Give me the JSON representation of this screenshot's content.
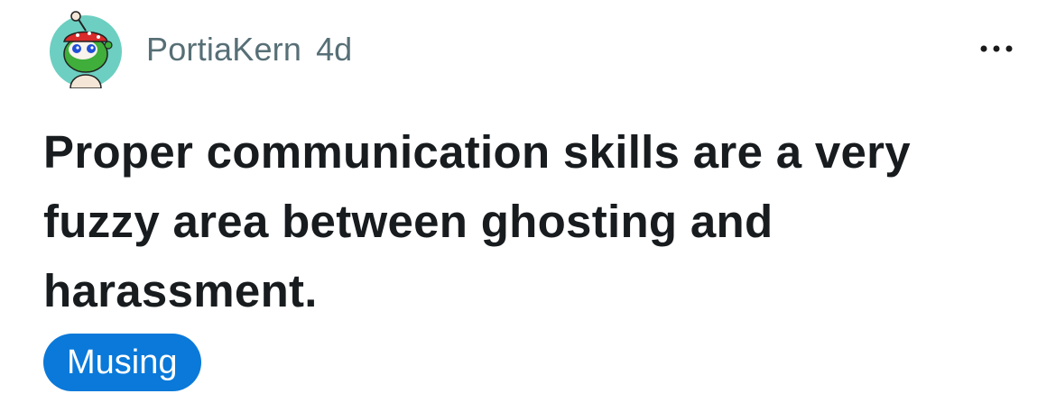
{
  "post": {
    "author": "PortiaKern",
    "age": "4d",
    "title": "Proper communication skills are a very fuzzy area between ghosting and harassment.",
    "flair": "Musing",
    "more_icon": "more-horizontal-icon",
    "avatar_icon": "snoo-avatar-icon"
  },
  "colors": {
    "flair_background": "#0a79d9",
    "meta_text": "#576f76",
    "title_text": "#181c1f"
  }
}
